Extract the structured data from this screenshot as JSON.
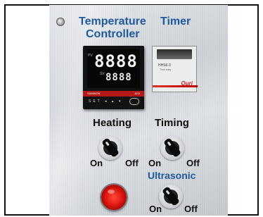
{
  "panel": {
    "title_line1": "Temperature",
    "title_line2": "Controller",
    "timer_title": "Timer",
    "heating_label": "Heating",
    "timing_label": "Timing",
    "ultrasonic_label": "Ultrasonic",
    "on_label": "On",
    "off_label": "Off"
  },
  "controller": {
    "pv_tag": "PV",
    "sv_tag": "SV",
    "pv_value": "8888",
    "sv_value": "8888",
    "strip_left": "SAMWON",
    "strip_right": "AX2",
    "buttons_text": "SET ◂ ▴ ▾"
  },
  "timer": {
    "model": "HHS6-3",
    "sub": "Time relay",
    "brand": "Ouri"
  },
  "colors": {
    "label_blue": "#1f5a9c",
    "lamp_red": "#e01810"
  }
}
